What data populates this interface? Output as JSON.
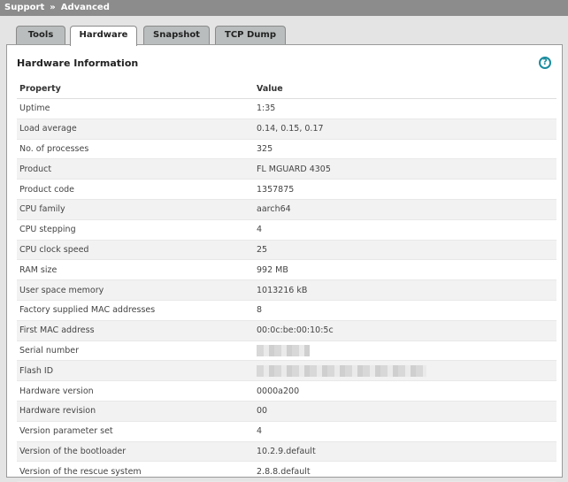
{
  "breadcrumb": {
    "parent": "Support",
    "separator": "»",
    "current": "Advanced"
  },
  "tabs": [
    {
      "label": "Tools",
      "active": false
    },
    {
      "label": "Hardware",
      "active": true
    },
    {
      "label": "Snapshot",
      "active": false
    },
    {
      "label": "TCP Dump",
      "active": false
    }
  ],
  "panel": {
    "title": "Hardware Information",
    "help_icon": "help-icon"
  },
  "table": {
    "headers": [
      "Property",
      "Value"
    ],
    "rows": [
      [
        "Uptime",
        "1:35"
      ],
      [
        "Load average",
        "0.14, 0.15, 0.17"
      ],
      [
        "No. of processes",
        "325"
      ],
      [
        "Product",
        "FL MGUARD 4305"
      ],
      [
        "Product code",
        "1357875"
      ],
      [
        "CPU family",
        "aarch64"
      ],
      [
        "CPU stepping",
        "4"
      ],
      [
        "CPU clock speed",
        "25"
      ],
      [
        "RAM size",
        "992 MB"
      ],
      [
        "User space memory",
        "1013216 kB"
      ],
      [
        "Factory supplied MAC addresses",
        "8"
      ],
      [
        "First MAC address",
        "00:0c:be:00:10:5c"
      ],
      [
        "Serial number",
        ""
      ],
      [
        "Flash ID",
        ""
      ],
      [
        "Hardware version",
        "0000a200"
      ],
      [
        "Hardware revision",
        "00"
      ],
      [
        "Version parameter set",
        "4"
      ],
      [
        "Version of the bootloader",
        "10.2.9.default"
      ],
      [
        "Version of the rescue system",
        "2.8.8.default"
      ]
    ]
  },
  "colors": {
    "topbar": "#8c8c8c",
    "tab_inactive": "#b9bdbd",
    "help": "#1a8c9e"
  }
}
